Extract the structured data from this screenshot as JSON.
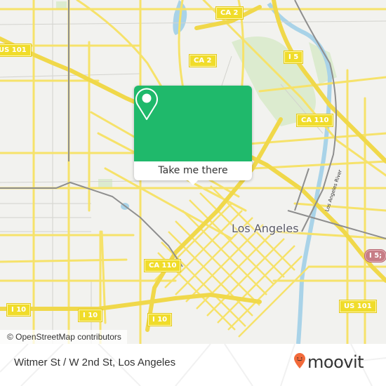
{
  "map": {
    "colors": {
      "land": "#f2f2ef",
      "road": "#f6e26a",
      "minor_road": "#c9c9c4",
      "rail": "#8e8e8e",
      "water": "#a9d3e8",
      "park": "#dcebcf"
    },
    "city_label": "Los Angeles",
    "river_label": "Los Angeles River",
    "shields": [
      {
        "label": "US 101",
        "type": "us-highway"
      },
      {
        "label": "CA 2",
        "type": "state-highway"
      },
      {
        "label": "CA 2",
        "type": "state-highway"
      },
      {
        "label": "I 5",
        "type": "interstate"
      },
      {
        "label": "CA 110",
        "type": "state-highway"
      },
      {
        "label": "CA 110",
        "type": "state-highway"
      },
      {
        "label": "I 5;",
        "type": "interstate-pink"
      },
      {
        "label": "US 101",
        "type": "us-highway"
      },
      {
        "label": "I 10",
        "type": "interstate"
      },
      {
        "label": "I 10",
        "type": "interstate"
      },
      {
        "label": "I 10",
        "type": "interstate"
      }
    ],
    "attribution": "© OpenStreetMap contributors"
  },
  "popup": {
    "icon": "map-pin-icon",
    "accent": "#1fb96b",
    "button_label": "Take me there"
  },
  "footer": {
    "title": "Witmer St / W 2nd St, Los Angeles",
    "brand": "moovit",
    "brand_color": "#f26a3a"
  }
}
